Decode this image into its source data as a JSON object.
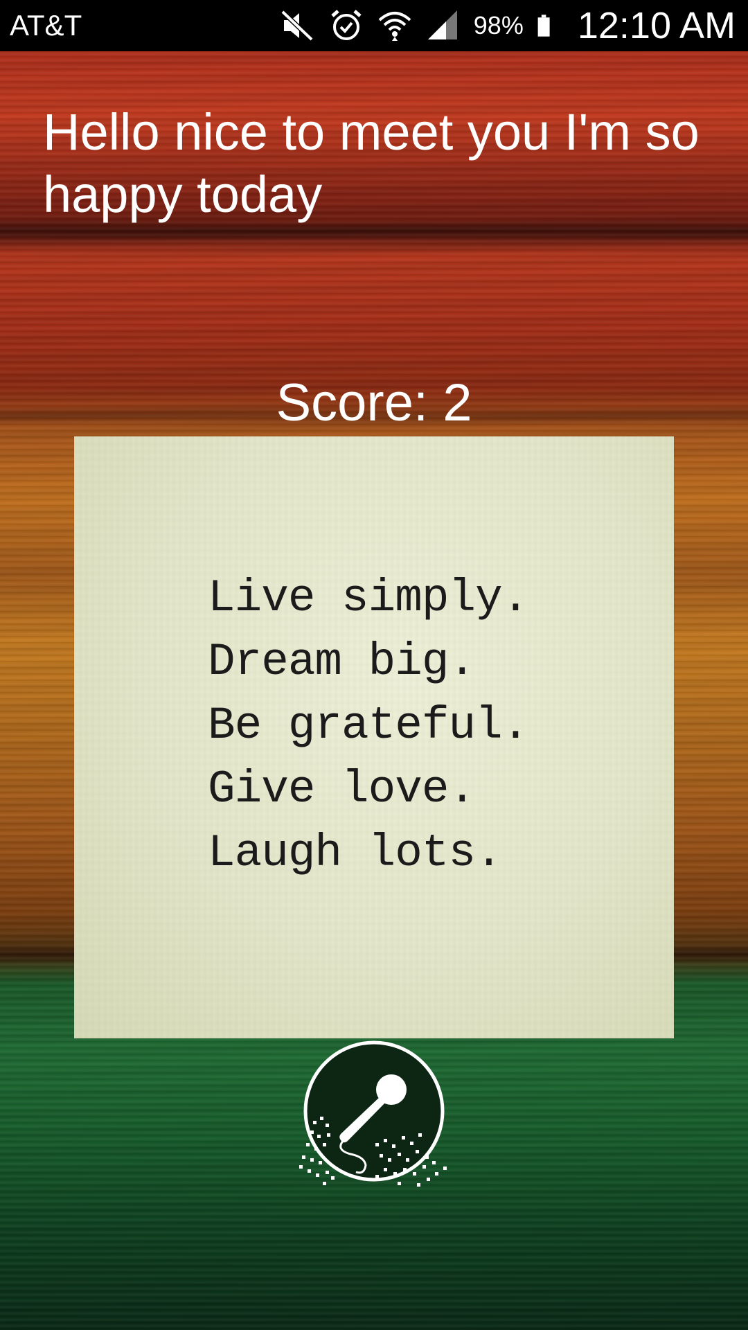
{
  "status_bar": {
    "carrier": "AT&T",
    "battery_percent": "98%",
    "time": "12:10 AM",
    "icons": [
      "mute-icon",
      "alarm-icon",
      "wifi-icon",
      "signal-icon",
      "battery-icon"
    ]
  },
  "message": {
    "text": "Hello nice to meet you I'm so happy today"
  },
  "score": {
    "label": "Score: 2"
  },
  "quote_card": {
    "lines": [
      "Live simply.",
      "Dream big.",
      "Be grateful.",
      "Give love.",
      "Laugh lots."
    ]
  },
  "mic": {
    "icon": "microphone-icon"
  },
  "colors": {
    "status_bar_bg": "#000000",
    "text": "#ffffff",
    "card_bg": "#e6e9cd",
    "mic_bg": "#0d2614"
  }
}
